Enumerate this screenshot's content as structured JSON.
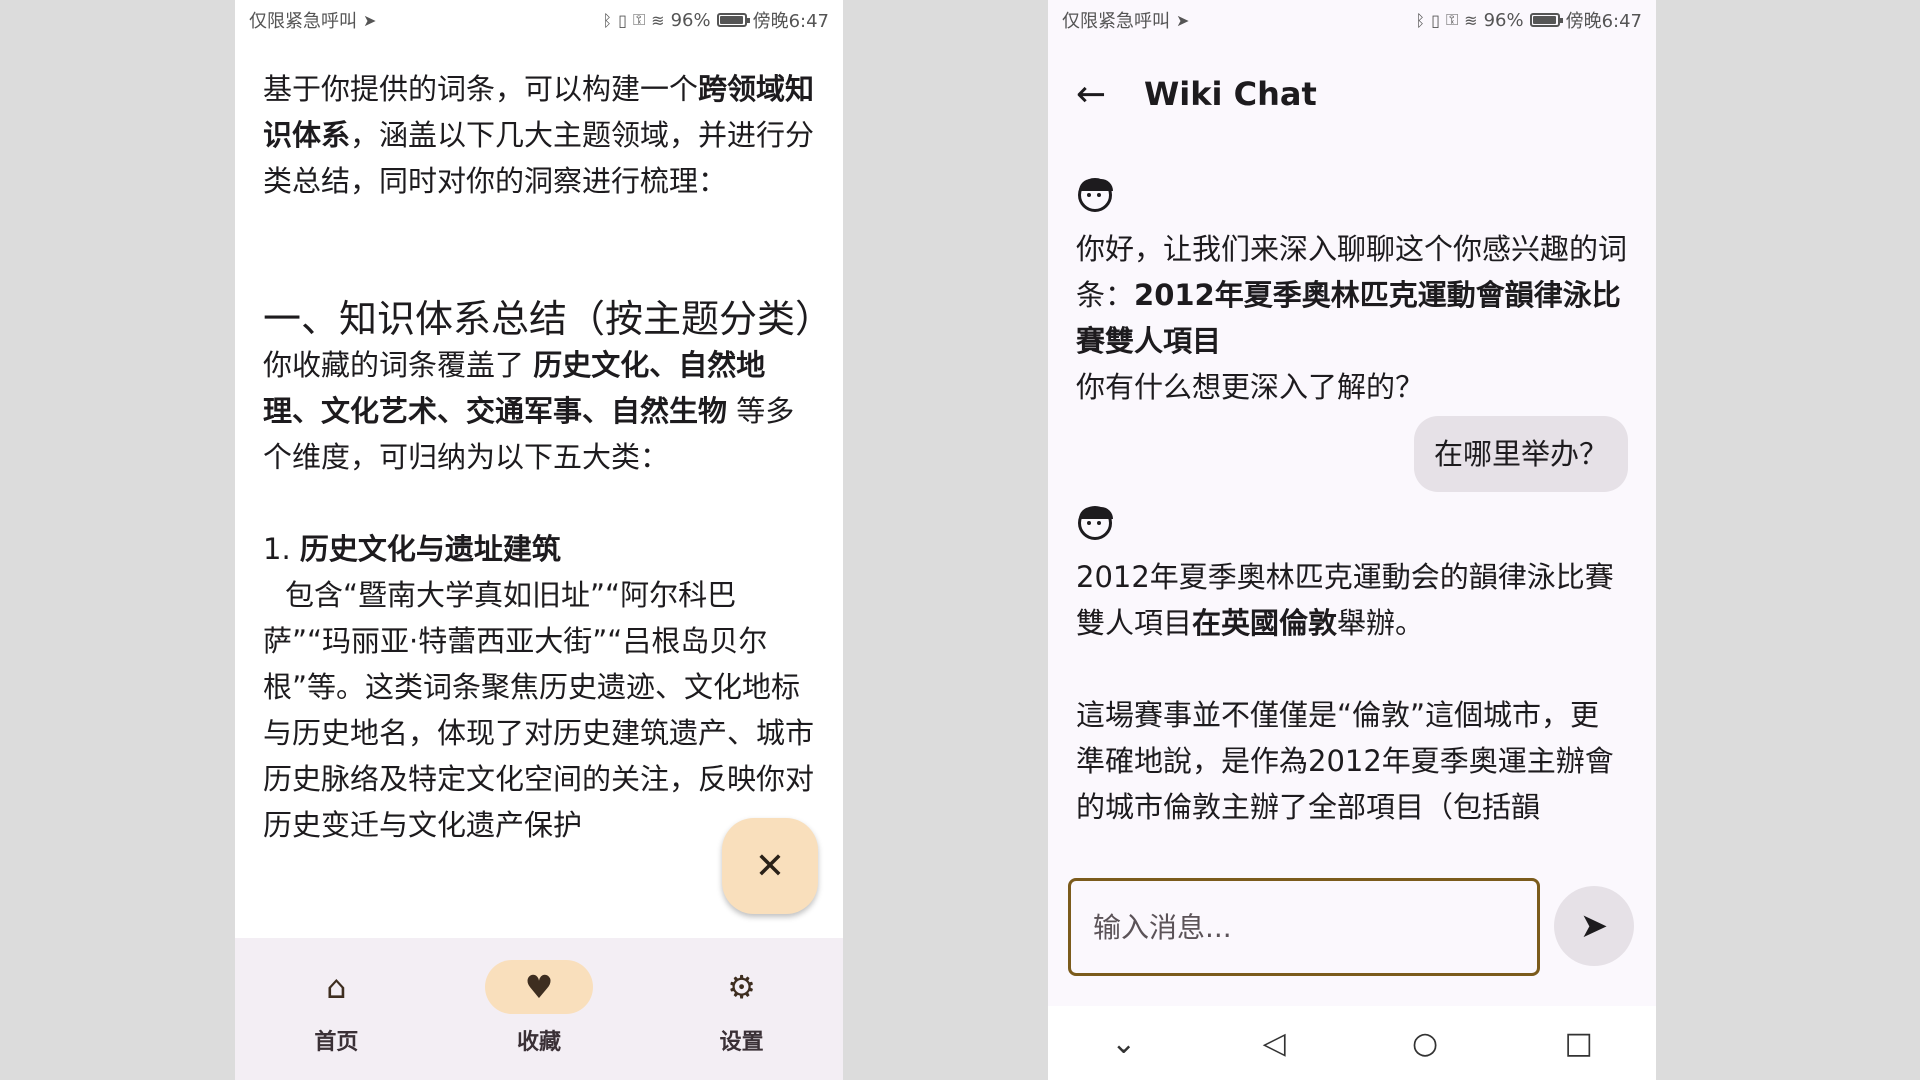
{
  "left": {
    "status": {
      "left": "仅限紧急呼叫",
      "battery": "96%",
      "time": "傍晚6:47"
    },
    "article": {
      "p1a": "基于你提供的词条，可以构建一个",
      "p1b": "跨领域知识体系",
      "p1c": "，涵盖以下几大主题领域，并进行分类总结，同时对你的洞察进行梳理：",
      "h2": "一、知识体系总结（按主题分类）",
      "p2a": "你收藏的词条覆盖了 ",
      "p2b": "历史文化、自然地理、文化艺术、交通军事、自然生物",
      "p2c": " 等多个维度，可归纳为以下五大类：",
      "item1_num": "1. ",
      "item1_title": "历史文化与遗址建筑",
      "item1_body": "包含“暨南大学真如旧址”“阿尔科巴萨”“玛丽亚·特蕾西亚大街”“吕根岛贝尔根”等。这类词条聚焦历史遗迹、文化地标与历史地名，体现了对历史建筑遗产、城市历史脉络及特定文化空间的关注，反映你对历史变迁与文化遗产保护"
    },
    "fab_icon": "close-icon",
    "nav": [
      {
        "label": "首页",
        "icon": "home-icon"
      },
      {
        "label": "收藏",
        "icon": "heart-icon"
      },
      {
        "label": "设置",
        "icon": "gear-icon"
      }
    ]
  },
  "right": {
    "status": {
      "left": "仅限紧急呼叫",
      "battery": "96%",
      "time": "傍晚6:47"
    },
    "title": "Wiki Chat",
    "messages": {
      "bot1a": "你好，让我们来深入聊聊这个你感兴趣的词条：",
      "bot1b": "2012年夏季奧林匹克運動會韻律泳比賽雙人項目",
      "bot1c": "你有什么想更深入了解的？",
      "user1": "在哪里举办？",
      "bot2a": "2012年夏季奧林匹克運動会的韻律泳比賽雙人項目",
      "bot2b": "在英國倫敦",
      "bot2c": "舉辦。",
      "bot3": "這場賽事並不僅僅是“倫敦”這個城市，更準確地說，是作為2012年夏季奧運主辦會的城市倫敦主辦了全部項目（包括韻"
    },
    "composer_placeholder": "输入消息...",
    "send_icon": "send-icon"
  }
}
